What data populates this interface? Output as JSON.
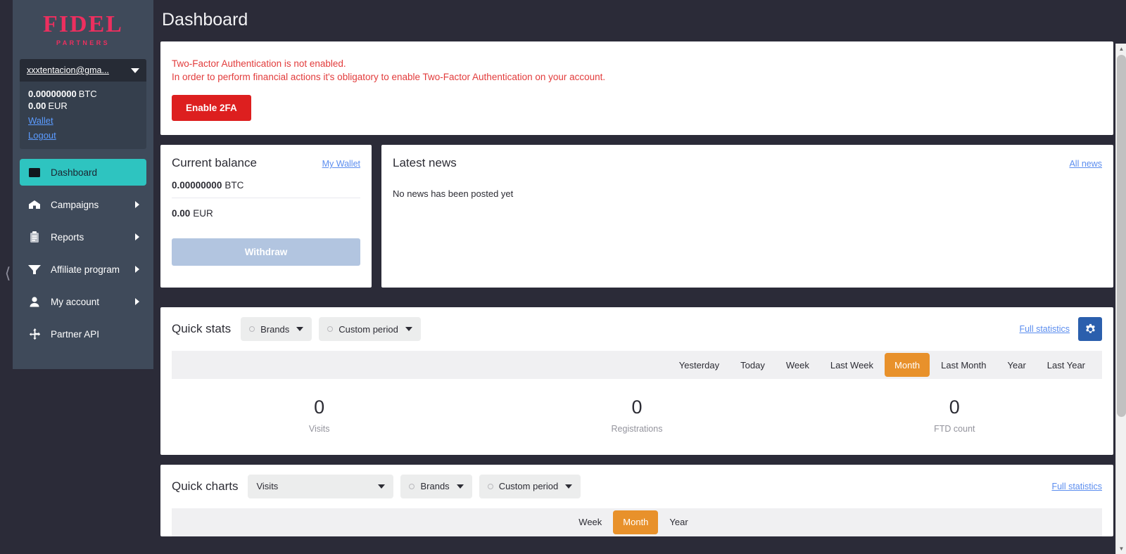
{
  "brand": {
    "logo_main": "FIDEL",
    "logo_sub": "PARTNERS"
  },
  "account": {
    "email": "xxxtentacion@gma...",
    "btc_amount": "0.00000000",
    "btc_currency": "BTC",
    "eur_amount": "0.00",
    "eur_currency": "EUR",
    "wallet_link": "Wallet",
    "logout_link": "Logout"
  },
  "sidebar": {
    "items": [
      {
        "label": "Dashboard",
        "icon": "dashboard-icon",
        "active": true,
        "has_arrow": false
      },
      {
        "label": "Campaigns",
        "icon": "megaphone-icon",
        "active": false,
        "has_arrow": true
      },
      {
        "label": "Reports",
        "icon": "clipboard-icon",
        "active": false,
        "has_arrow": true
      },
      {
        "label": "Affiliate program",
        "icon": "funnel-icon",
        "active": false,
        "has_arrow": true
      },
      {
        "label": "My account",
        "icon": "user-icon",
        "active": false,
        "has_arrow": true
      },
      {
        "label": "Partner API",
        "icon": "move-icon",
        "active": false,
        "has_arrow": false
      }
    ],
    "collapse_icon": "chevron-left-icon"
  },
  "header": {
    "title": "Dashboard"
  },
  "tfa": {
    "line1": "Two-Factor Authentication is not enabled.",
    "line2": "In order to perform financial actions it's obligatory to enable Two-Factor Authentication on your account.",
    "button": "Enable 2FA",
    "button_color": "#dd1f1f",
    "text_color": "#e23b3b"
  },
  "balance": {
    "title": "Current balance",
    "wallet_link": "My Wallet",
    "btc_amount": "0.00000000",
    "btc_currency": "BTC",
    "eur_amount": "0.00",
    "eur_currency": "EUR",
    "withdraw_button": "Withdraw"
  },
  "news": {
    "title": "Latest news",
    "all_link": "All news",
    "empty_message": "No news has been posted yet"
  },
  "quick_stats": {
    "title": "Quick stats",
    "brands_filter": "Brands",
    "period_filter": "Custom period",
    "full_statistics_link": "Full statistics",
    "gear_icon": "gear-icon",
    "periods": [
      "Yesterday",
      "Today",
      "Week",
      "Last Week",
      "Month",
      "Last Month",
      "Year",
      "Last Year"
    ],
    "active_period": "Month",
    "stats": [
      {
        "value": "0",
        "label": "Visits"
      },
      {
        "value": "0",
        "label": "Registrations"
      },
      {
        "value": "0",
        "label": "FTD count"
      }
    ]
  },
  "quick_charts": {
    "title": "Quick charts",
    "metric_select": "Visits",
    "brands_filter": "Brands",
    "period_filter": "Custom period",
    "full_statistics_link": "Full statistics",
    "periods": [
      "Week",
      "Month",
      "Year"
    ],
    "active_period": "Month"
  },
  "colors": {
    "accent_teal": "#2ec4c0",
    "accent_orange": "#e8912b",
    "brand_pink": "#ec2f5f",
    "link_blue": "#5b8def",
    "sidebar_bg": "#3f4a5a",
    "page_bg": "#2b2b38"
  }
}
